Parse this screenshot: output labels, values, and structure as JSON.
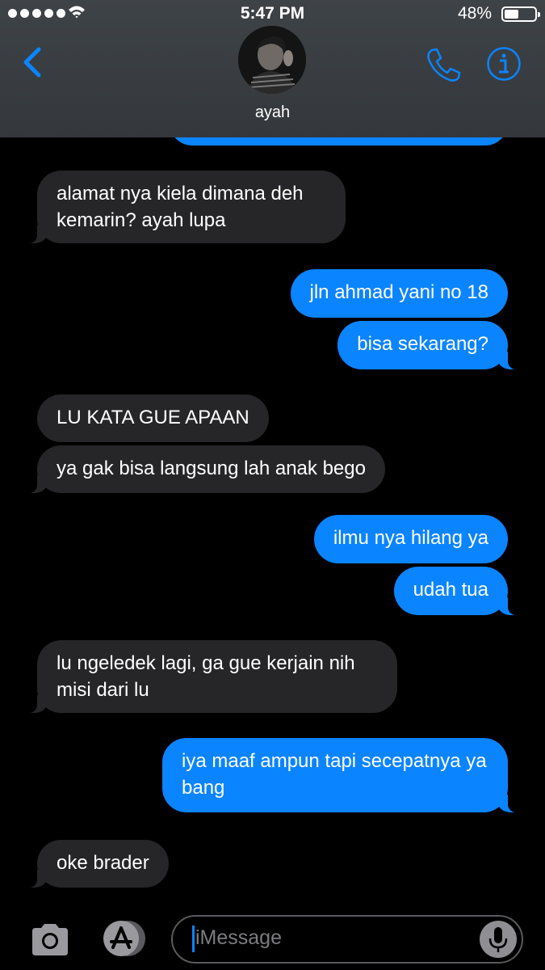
{
  "status_bar": {
    "time": "5:47 PM",
    "battery_percent": "48%",
    "battery_level": 0.48,
    "signal_bars": 5
  },
  "header": {
    "contact_name": "ayah",
    "icons": [
      "back-chevron-icon",
      "contact-avatar",
      "phone-icon",
      "info-icon"
    ],
    "accent_color": "#0b84ff"
  },
  "messages": [
    {
      "direction": "outgoing",
      "text": ""
    },
    {
      "direction": "incoming",
      "text": "alamat nya kiela dimana deh kemarin? ayah lupa"
    },
    {
      "direction": "outgoing",
      "text": "jln ahmad yani no 18"
    },
    {
      "direction": "outgoing",
      "text": "bisa sekarang?"
    },
    {
      "direction": "incoming",
      "text": "LU KATA GUE APAAN"
    },
    {
      "direction": "incoming",
      "text": "ya gak bisa langsung lah anak bego"
    },
    {
      "direction": "outgoing",
      "text": "ilmu nya hilang ya"
    },
    {
      "direction": "outgoing",
      "text": "udah tua"
    },
    {
      "direction": "incoming",
      "text": "lu ngeledek lagi, ga gue kerjain nih misi dari lu"
    },
    {
      "direction": "outgoing",
      "text": "iya maaf ampun tapi secepatnya ya bang"
    },
    {
      "direction": "incoming",
      "text": "oke brader"
    }
  ],
  "input_bar": {
    "placeholder": "iMessage",
    "icons": [
      "camera-icon",
      "app-store-icon",
      "microphone-icon"
    ]
  },
  "colors": {
    "incoming_bubble": "#262628",
    "outgoing_bubble": "#0b84ff",
    "header_background": "#3e4347"
  }
}
